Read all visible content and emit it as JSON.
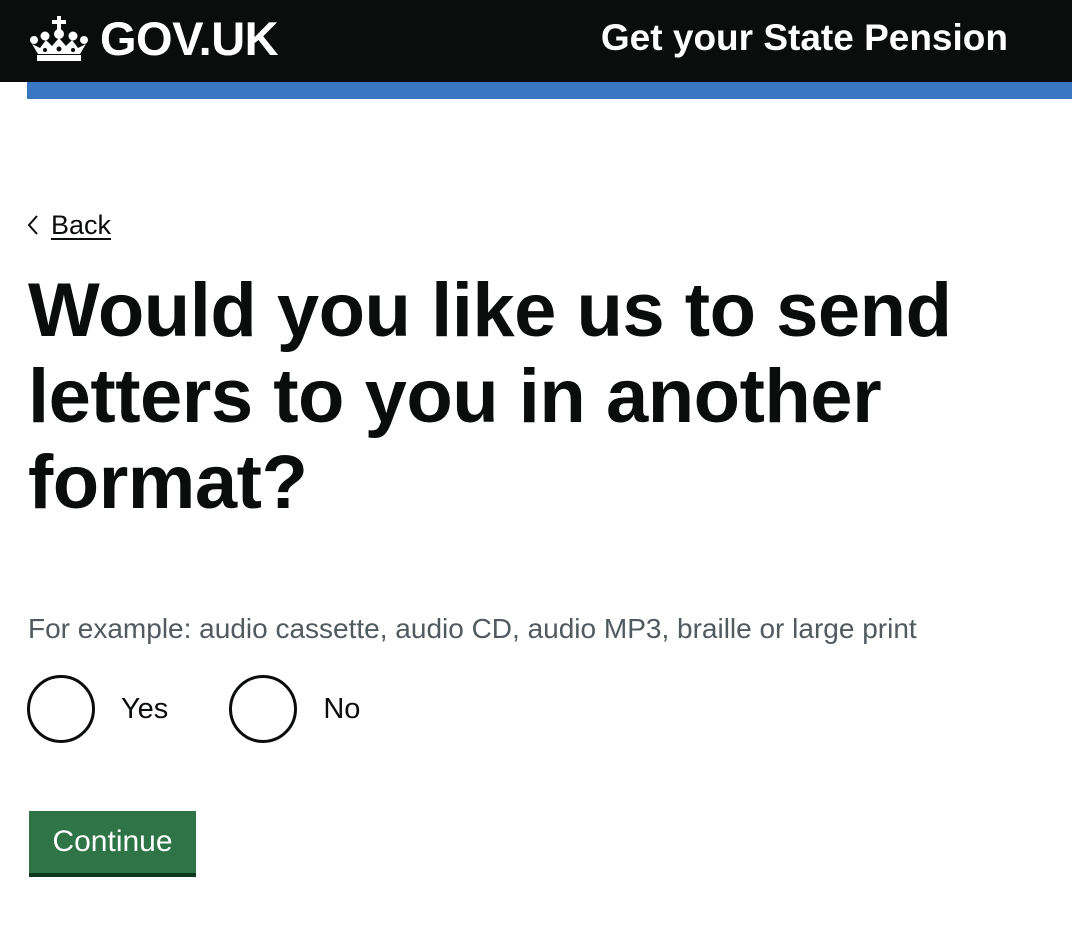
{
  "header": {
    "logo_text": "GOV.UK",
    "service_name": "Get your State Pension",
    "colors": {
      "background": "#0b0c0c",
      "bar": "#3a77c2"
    }
  },
  "back_link": {
    "label": "Back",
    "icon": "chevron-left-icon"
  },
  "question": {
    "heading": "Would you like us to send letters to you in another format?",
    "hint": "For example: audio cassette, audio CD, audio MP3, braille or large print",
    "options": [
      {
        "label": "Yes",
        "selected": false
      },
      {
        "label": "No",
        "selected": false
      }
    ]
  },
  "actions": {
    "continue_label": "Continue",
    "continue_color": "#2e7446"
  }
}
